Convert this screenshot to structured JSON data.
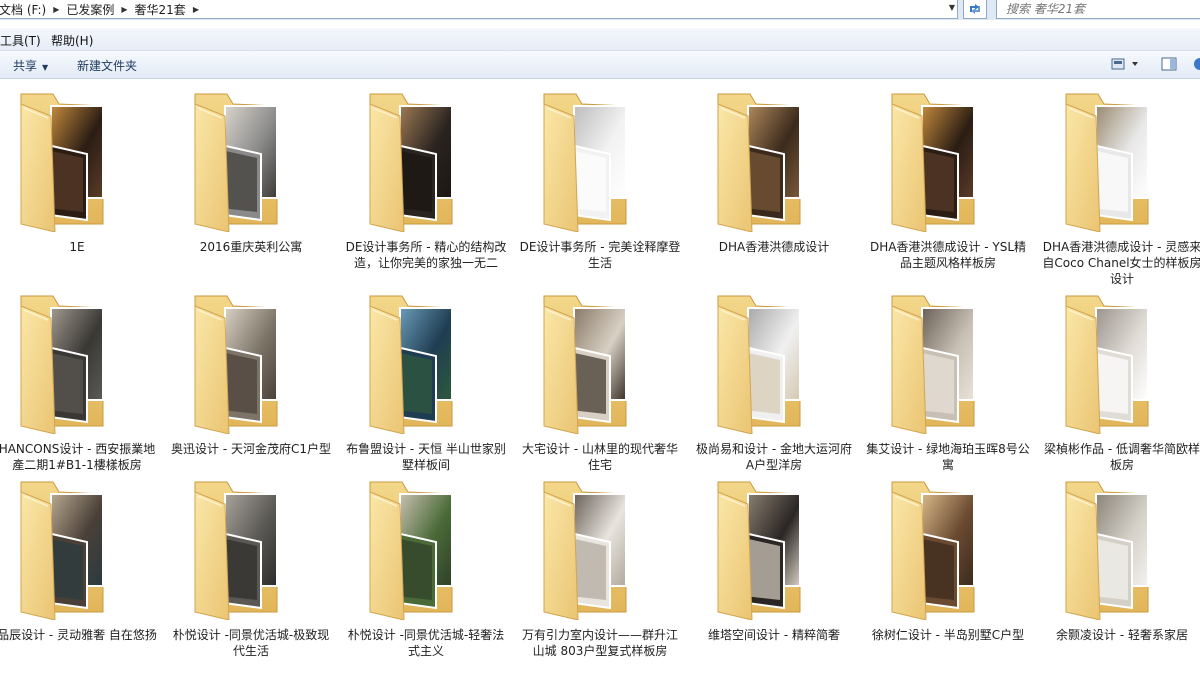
{
  "address_bar": {
    "crumbs": [
      "文档 (F:)",
      "已发案例",
      "奢华21套"
    ]
  },
  "search": {
    "placeholder": "搜索 奢华21套"
  },
  "menu": {
    "tools": "工具(T)",
    "help": "帮助(H)"
  },
  "toolbar": {
    "share": "共享",
    "new_folder": "新建文件夹"
  },
  "folders": [
    {
      "name": "1E",
      "colors": [
        "#2b1d14",
        "#c48a3c",
        "#5a3c28"
      ]
    },
    {
      "name": "2016重庆英利公寓",
      "colors": [
        "#8a8a8a",
        "#d9d4cc",
        "#3d3a36"
      ]
    },
    {
      "name": "DE设计事务所 - 精心的结构改造，让你完美的家独一无二",
      "colors": [
        "#2a2420",
        "#9e7a55",
        "#1b1612"
      ]
    },
    {
      "name": "DE设计事务所 - 完美诠释摩登生活",
      "colors": [
        "#f2f2f2",
        "#bdbdbd",
        "#ffffff"
      ]
    },
    {
      "name": "DHA香港洪德成设计",
      "colors": [
        "#3b2a1c",
        "#b0895c",
        "#7a5a3a"
      ]
    },
    {
      "name": "DHA香港洪德成设计 - YSL精品主题风格样板房",
      "colors": [
        "#2b1d14",
        "#c48a3c",
        "#5a3c28"
      ]
    },
    {
      "name": "DHA香港洪德成设计 - 灵感来自Coco Chanel女士的样板房设计",
      "colors": [
        "#e8e8e8",
        "#9a8a70",
        "#ffffff"
      ]
    },
    {
      "name": "HANCONS设计 - 西安振業地產二期1#B1-1樓樣板房",
      "colors": [
        "#3a3834",
        "#a09a90",
        "#5c5a56"
      ]
    },
    {
      "name": "奥迅设计 - 天河金茂府C1户型",
      "colors": [
        "#7d7468",
        "#d8d0c4",
        "#4a4038"
      ]
    },
    {
      "name": "布鲁盟设计 - 天恒 半山世家别墅样板间",
      "colors": [
        "#1f3d52",
        "#6b9bb8",
        "#2f5a3a"
      ]
    },
    {
      "name": "大宅设计 - 山林里的现代奢华住宅",
      "colors": [
        "#d8d0c4",
        "#8a7a68",
        "#3a3028"
      ]
    },
    {
      "name": "极尚易和设计 - 金地大运河府A户型洋房",
      "colors": [
        "#f0f0f0",
        "#a8a8a8",
        "#d4c8b0"
      ]
    },
    {
      "name": "集艾设计 - 绿地海珀玉晖8号公寓",
      "colors": [
        "#c8c0b4",
        "#6a6058",
        "#e8e2d8"
      ]
    },
    {
      "name": "梁楨彬作品 - 低调奢华简欧样板房",
      "colors": [
        "#e0dcd6",
        "#9a948c",
        "#ffffff"
      ]
    },
    {
      "name": "品辰设计 - 灵动雅奢 自在悠扬",
      "colors": [
        "#4a4038",
        "#b8a890",
        "#2a3a40"
      ]
    },
    {
      "name": "朴悦设计 -同景优活城-极致现代生活",
      "colors": [
        "#5a5854",
        "#a8a49c",
        "#2e2c2a"
      ]
    },
    {
      "name": "朴悦设计 -同景优活城-轻奢法式主义",
      "colors": [
        "#4a6a38",
        "#c8c0b0",
        "#2e4028"
      ]
    },
    {
      "name": "万有引力室内设计——群升江山城 803户型复式样板房",
      "colors": [
        "#e8e4de",
        "#6a625a",
        "#b0a89c"
      ]
    },
    {
      "name": "维塔空间设计 - 精粹简奢",
      "colors": [
        "#2a2624",
        "#8a7e70",
        "#d8d0c4"
      ]
    },
    {
      "name": "徐树仁设计 - 半岛别墅C户型",
      "colors": [
        "#6a4a30",
        "#d8b888",
        "#3a2a1c"
      ]
    },
    {
      "name": "余颢凌设计 - 轻奢系家居",
      "colors": [
        "#d4d0c8",
        "#8a8478",
        "#f4f2ee"
      ]
    }
  ]
}
